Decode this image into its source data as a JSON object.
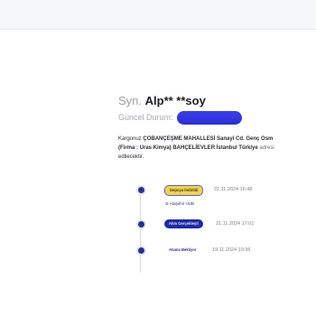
{
  "header": {
    "salutation": "Syn.",
    "customer_name": "Alp** **soy",
    "status_label": "Güncel Durum:",
    "status_color": "#3b3fe8"
  },
  "description": {
    "line1_prefix": "Kargonuz ",
    "line1_bold": "ÇOBANÇEŞME MAHALLESİ Sanayi Cd. Genç Osm",
    "line2_bold": "(Firma : Uras Kimya) BAHÇELİEVLER İstanbul Türkiye",
    "line2_suffix": " adresi",
    "line3": "edilecektir."
  },
  "timeline": [
    {
      "badge": "Depoya İndirildi",
      "time": "22.11.2024 16:48",
      "sub": "Ataşehir HUB"
    },
    {
      "badge": "Alım Gerçekleşti",
      "time": "21.11.2024 17:01"
    },
    {
      "badge": "Atama Bekliyor",
      "time": "19.11.2024 19:36"
    }
  ],
  "colors": {
    "accent": "#2b2f8f",
    "badge_yellow": "#f2d34a",
    "badge_blue": "#1e2aa0"
  }
}
